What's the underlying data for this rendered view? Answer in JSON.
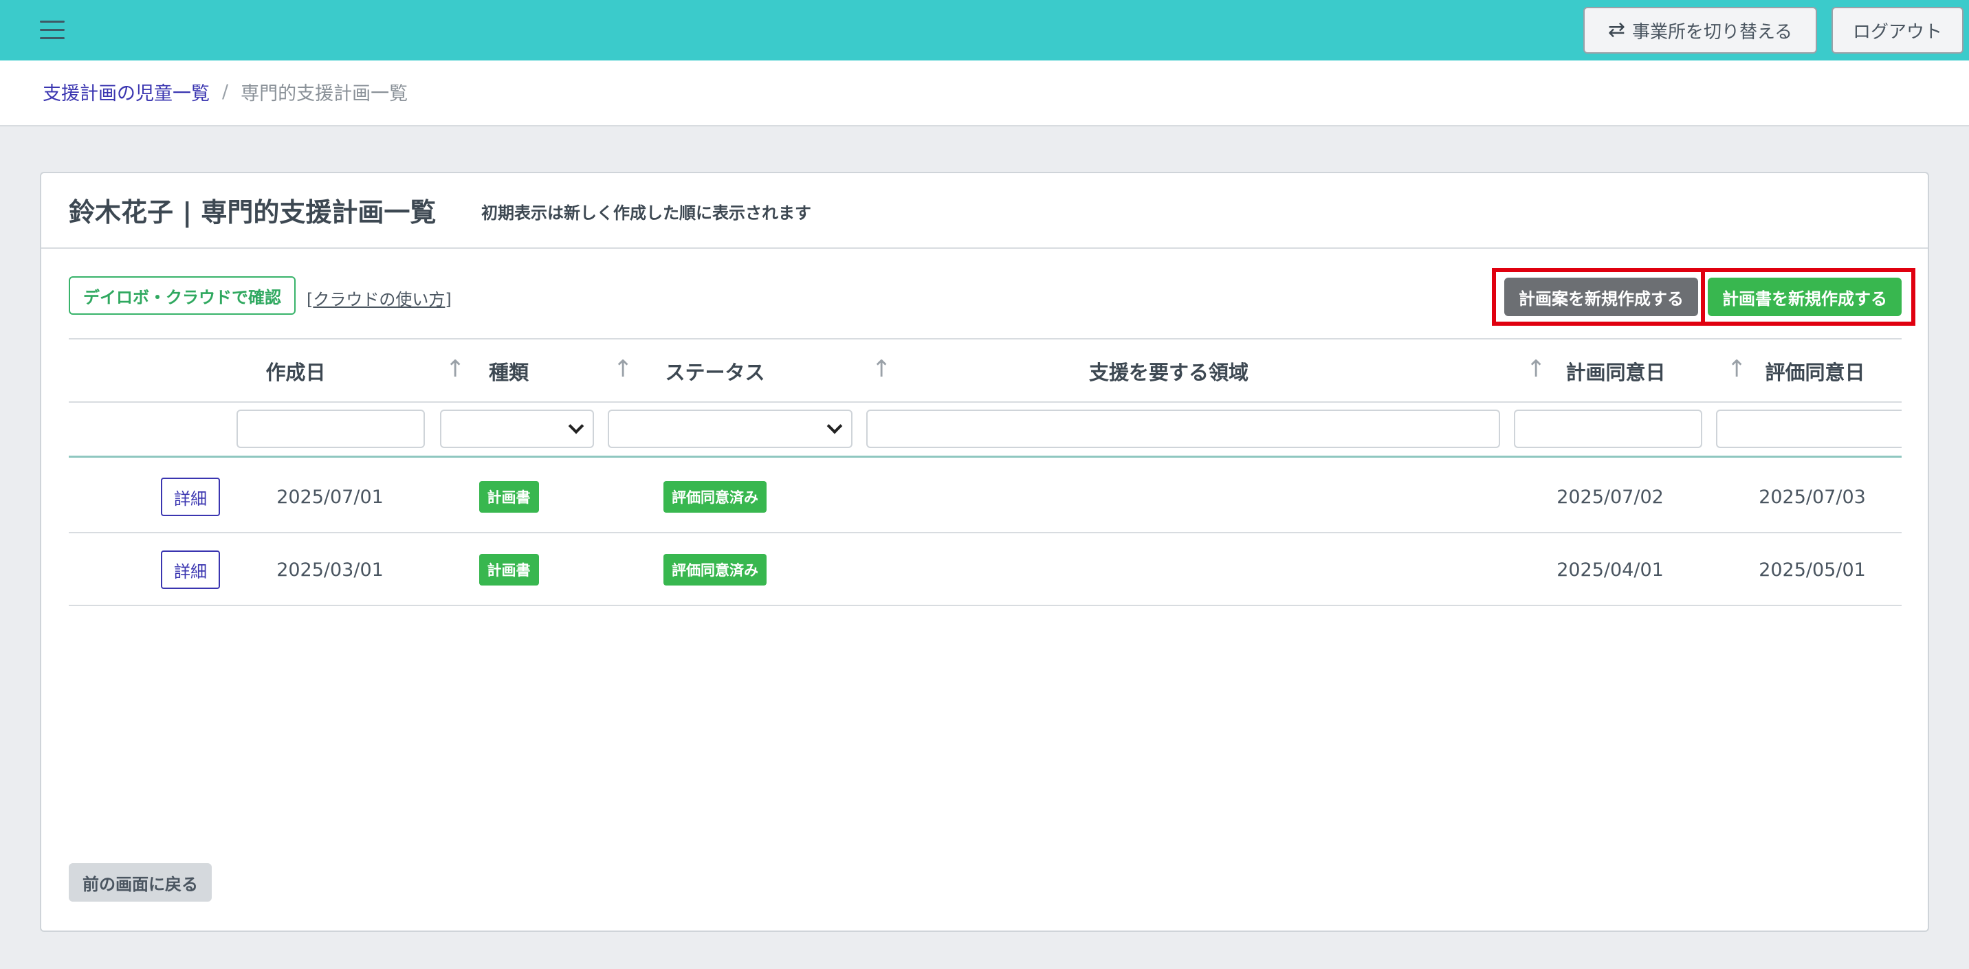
{
  "topbar": {
    "menu_icon": "hamburger-menu-icon",
    "switch_icon": "swap-arrows-icon",
    "switch_label": "事業所を切り替える",
    "logout_label": "ログアウト"
  },
  "breadcrumb": {
    "link": "支援計画の児童一覧",
    "separator": "/",
    "current": "専門的支援計画一覧"
  },
  "card": {
    "title": "鈴木花子 | 専門的支援計画一覧",
    "note": "初期表示は新しく作成した順に表示されます",
    "cloud_button": "デイロボ・クラウドで確認",
    "cloud_help_open": "[",
    "cloud_help_link": "クラウドの使い方",
    "cloud_help_close": "]",
    "draft_button": "計画案を新規作成する",
    "plan_button": "計画書を新規作成する",
    "back_button": "前の画面に戻る"
  },
  "table": {
    "sort_icon": "↑",
    "columns": [
      "作成日",
      "種類",
      "ステータス",
      "支援を要する領域",
      "計画同意日",
      "評価同意日"
    ],
    "rows": [
      {
        "action": "詳細",
        "created": "2025/07/01",
        "type": "計画書",
        "status": "評価同意済み",
        "domain": "",
        "plan_agree": "2025/07/02",
        "eval_agree": "2025/07/03"
      },
      {
        "action": "詳細",
        "created": "2025/03/01",
        "type": "計画書",
        "status": "評価同意済み",
        "domain": "",
        "plan_agree": "2025/04/01",
        "eval_agree": "2025/05/01"
      }
    ]
  },
  "colors": {
    "topbar": "#3bcbcb",
    "link": "#3a35b0",
    "green": "#38b74f",
    "highlight": "#e0000f",
    "gray_button": "#6c6f73"
  }
}
